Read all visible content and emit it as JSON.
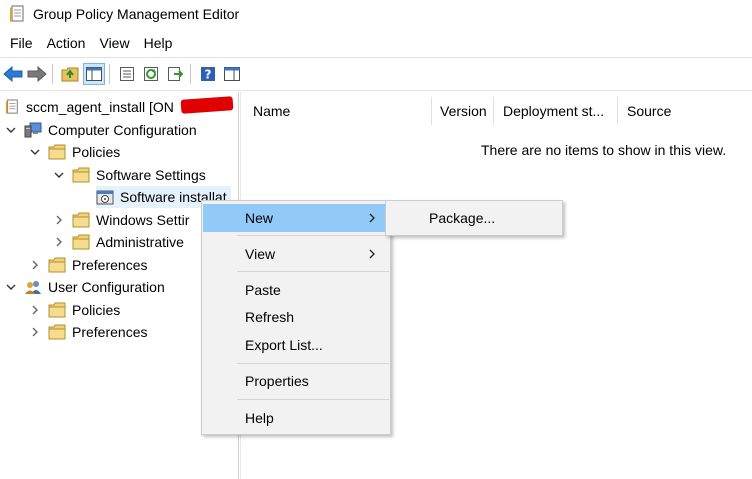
{
  "window": {
    "title": "Group Policy Management Editor"
  },
  "menubar": {
    "items": [
      "File",
      "Action",
      "View",
      "Help"
    ]
  },
  "toolbar": {
    "buttons": [
      "back-icon",
      "forward-icon",
      "up-folder-icon",
      "show-hide-tree-icon",
      "properties-icon",
      "refresh-icon",
      "export-list-icon",
      "help-icon",
      "action-pane-icon"
    ]
  },
  "tree": {
    "root": "sccm_agent_install [ON",
    "computer_configuration": "Computer Configuration",
    "cc_policies": "Policies",
    "software_settings": "Software Settings",
    "software_installation": "Software installat",
    "windows_settings": "Windows Settir",
    "administrative": "Administrative",
    "cc_preferences": "Preferences",
    "user_configuration": "User Configuration",
    "uc_policies": "Policies",
    "uc_preferences": "Preferences"
  },
  "list": {
    "columns": [
      "Name",
      "Version",
      "Deployment st...",
      "Source"
    ],
    "empty_message": "There are no items to show in this view."
  },
  "context_menu": {
    "new": "New",
    "view": "View",
    "paste": "Paste",
    "refresh": "Refresh",
    "export_list": "Export List...",
    "properties": "Properties",
    "help": "Help"
  },
  "submenu": {
    "package": "Package..."
  },
  "colors": {
    "hover": "#91c9f7",
    "menu_bg": "#f2f2f2",
    "folder": "#e8c25a"
  }
}
